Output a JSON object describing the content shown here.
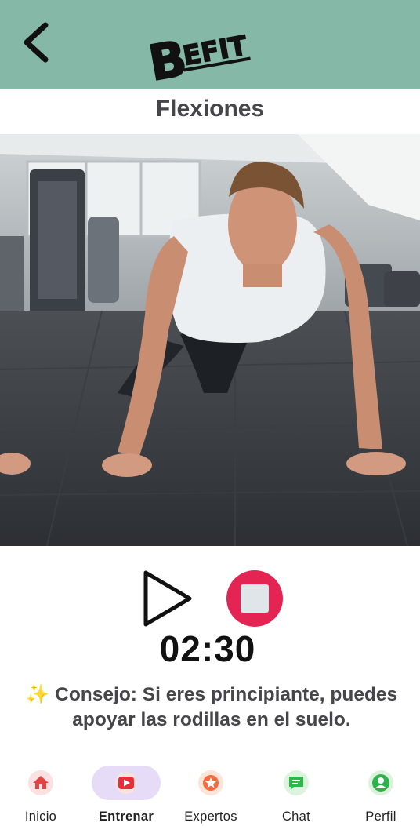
{
  "header": {
    "logo_text": "BEFIT",
    "back_icon": "chevron-left-icon",
    "background_color": "#86b8a8"
  },
  "exercise": {
    "title": "Flexiones"
  },
  "player": {
    "play_icon": "play-icon",
    "stop_icon": "stop-icon",
    "stop_color": "#e42553",
    "timer": "02:30"
  },
  "tip": {
    "emoji": "✨",
    "text": "Consejo: Si eres principiante, puedes apoyar las rodillas en el suelo."
  },
  "nav": {
    "active_pill_color": "#e6dcf7",
    "items": [
      {
        "label": "Inicio",
        "icon": "home-icon",
        "active": false
      },
      {
        "label": "Entrenar",
        "icon": "play-video-icon",
        "active": true
      },
      {
        "label": "Expertos",
        "icon": "star-icon",
        "active": false
      },
      {
        "label": "Chat",
        "icon": "chat-icon",
        "active": false
      },
      {
        "label": "Perfil",
        "icon": "profile-icon",
        "active": false
      }
    ]
  }
}
